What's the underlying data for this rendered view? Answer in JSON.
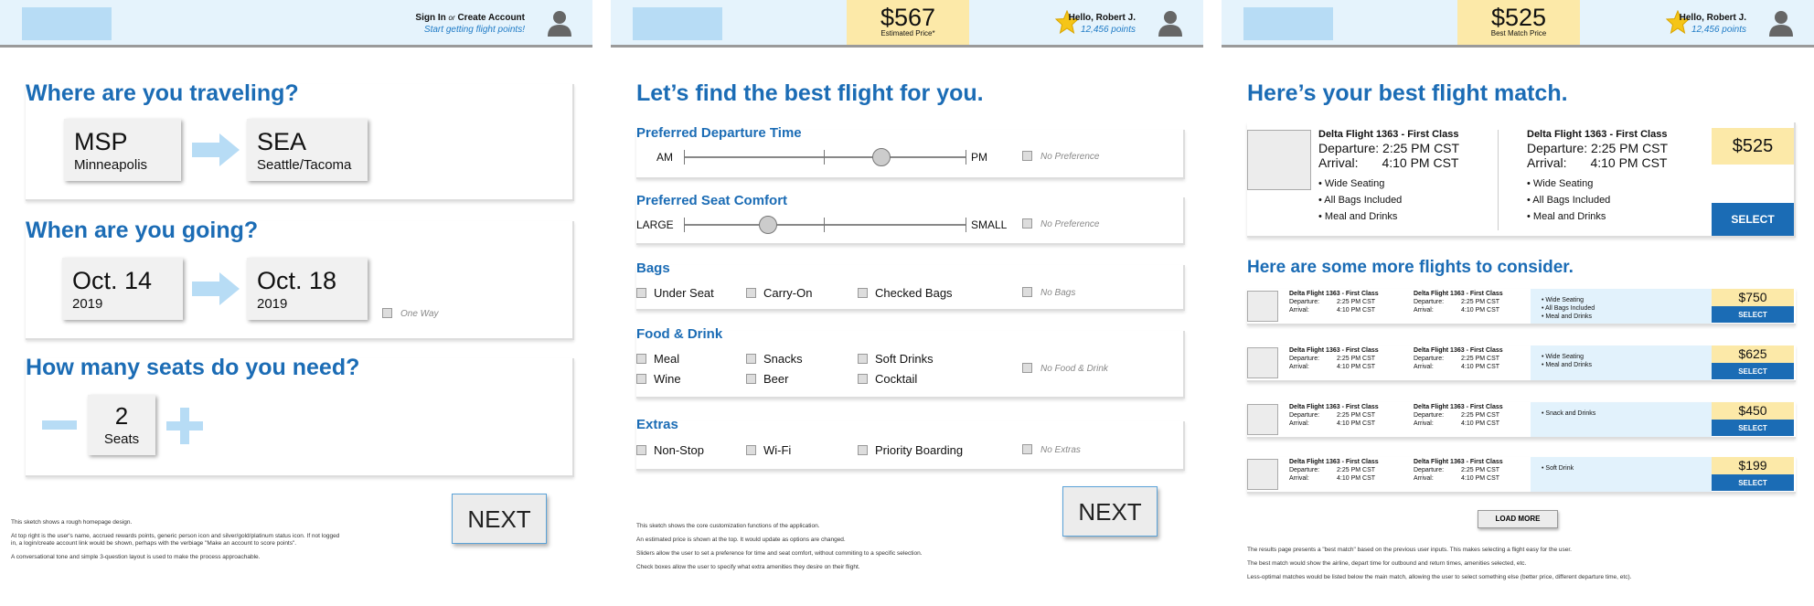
{
  "screen1": {
    "header": {
      "sign_in": "Sign In",
      "or": "or",
      "create_account": "Create Account",
      "subtitle": "Start getting flight points!"
    },
    "q1": "Where are you traveling?",
    "origin": {
      "code": "MSP",
      "city": "Minneapolis"
    },
    "destination": {
      "code": "SEA",
      "city": "Seattle/Tacoma"
    },
    "q2": "When are you going?",
    "depart": {
      "date": "Oct. 14",
      "year": "2019"
    },
    "return": {
      "date": "Oct. 18",
      "year": "2019"
    },
    "one_way": "One Way",
    "q3": "How many seats do you need?",
    "seats": {
      "count": "2",
      "label": "Seats"
    },
    "next": "NEXT",
    "notes": [
      "This sketch shows a rough homepage design.",
      "At top right is the user's name, accrued rewards points, generic person icon and silver/gold/platinum status icon. If not logged in, a login/create account link would be shown, perhaps with the verbiage \"Make an account to score points\".",
      "A conversational tone and simple 3-question layout is used to make the process approachable."
    ]
  },
  "screen2": {
    "header": {
      "price": "$567",
      "price_label": "Estimated Price*",
      "greeting": "Hello, Robert J.",
      "points": "12,456 points"
    },
    "title": "Let’s find the best flight for you.",
    "departure": {
      "label": "Preferred Departure Time",
      "min": "AM",
      "max": "PM",
      "value": 0.7,
      "no_pref": "No Preference"
    },
    "comfort": {
      "label": "Preferred Seat Comfort",
      "min": "LARGE",
      "max": "SMALL",
      "value": 0.3,
      "no_pref": "No Preference"
    },
    "bags": {
      "label": "Bags",
      "options": [
        "Under Seat",
        "Carry-On",
        "Checked Bags"
      ],
      "none": "No Bags"
    },
    "food": {
      "label": "Food & Drink",
      "options": [
        "Meal",
        "Snacks",
        "Soft Drinks",
        "Wine",
        "Beer",
        "Cocktail"
      ],
      "none": "No Food & Drink"
    },
    "extras": {
      "label": "Extras",
      "options": [
        "Non-Stop",
        "Wi-Fi",
        "Priority Boarding"
      ],
      "none": "No Extras"
    },
    "next": "NEXT",
    "notes": [
      "This sketch shows the core customization functions of the application.",
      "An estimated price is shown at the top. It would update as options are changed.",
      "Sliders allow the user to set a preference for time and seat comfort, without commiting to a specific selection.",
      "Check boxes allow the user to specify what extra amenities they desire on their flight."
    ]
  },
  "screen3": {
    "header": {
      "price": "$525",
      "price_label": "Best Match Price",
      "greeting": "Hello, Robert J.",
      "points": "12,456 points"
    },
    "title": "Here’s your best flight match.",
    "best": {
      "outbound": {
        "flight": "Delta Flight 1363 - First Class",
        "dep_label": "Departure:",
        "dep": "2:25 PM CST",
        "arr_label": "Arrival:",
        "arr": "4:10 PM CST"
      },
      "inbound": {
        "flight": "Delta Flight 1363 - First Class",
        "dep_label": "Departure:",
        "dep": "2:25 PM CST",
        "arr_label": "Arrival:",
        "arr": "4:10 PM CST"
      },
      "amenities": [
        "• Wide Seating",
        "• All Bags Included",
        "• Meal and Drinks"
      ],
      "price": "$525",
      "select": "SELECT"
    },
    "more_title": "Here are some more flights to consider.",
    "others": [
      {
        "flight": "Delta Flight 1363 - First Class",
        "dep_label": "Departure:",
        "dep": "2:25 PM CST",
        "arr_label": "Arrival:",
        "arr": "4:10 PM CST",
        "amenities": [
          "• Wide Seating",
          "• All Bags Included",
          "• Meal and Drinks"
        ],
        "price": "$750",
        "select": "SELECT"
      },
      {
        "flight": "Delta Flight 1363 - First Class",
        "dep_label": "Departure:",
        "dep": "2:25 PM CST",
        "arr_label": "Arrival:",
        "arr": "4:10 PM CST",
        "amenities": [
          "• Wide Seating",
          "• Meal and Drinks",
          ""
        ],
        "price": "$625",
        "select": "SELECT"
      },
      {
        "flight": "Delta Flight 1363 - First Class",
        "dep_label": "Departure:",
        "dep": "2:25 PM CST",
        "arr_label": "Arrival:",
        "arr": "4:10 PM CST",
        "amenities": [
          "• Snack and Drinks",
          "",
          ""
        ],
        "price": "$450",
        "select": "SELECT"
      },
      {
        "flight": "Delta Flight 1363 - First Class",
        "dep_label": "Departure:",
        "dep": "2:25 PM CST",
        "arr_label": "Arrival:",
        "arr": "4:10 PM CST",
        "amenities": [
          "• Soft Drink",
          "",
          ""
        ],
        "price": "$199",
        "select": "SELECT"
      }
    ],
    "load_more": "LOAD MORE",
    "notes": [
      "The results page presents a \"best match\" based on the previous user inputs. This makes selecting a flight easy for the user.",
      "The best match would show the airline, depart time for outbound and return times, amenities selected, etc.",
      "Less-optimal matches would be listed below the main match, allowing the user to select something else (better price, different departure time, etc)."
    ]
  },
  "colors": {
    "accent": "#1b6cb5",
    "header_bg": "#e5f3fc",
    "price_bg": "#fce9a8",
    "arrow": "#b7dcf5",
    "star": "#f5c518"
  }
}
